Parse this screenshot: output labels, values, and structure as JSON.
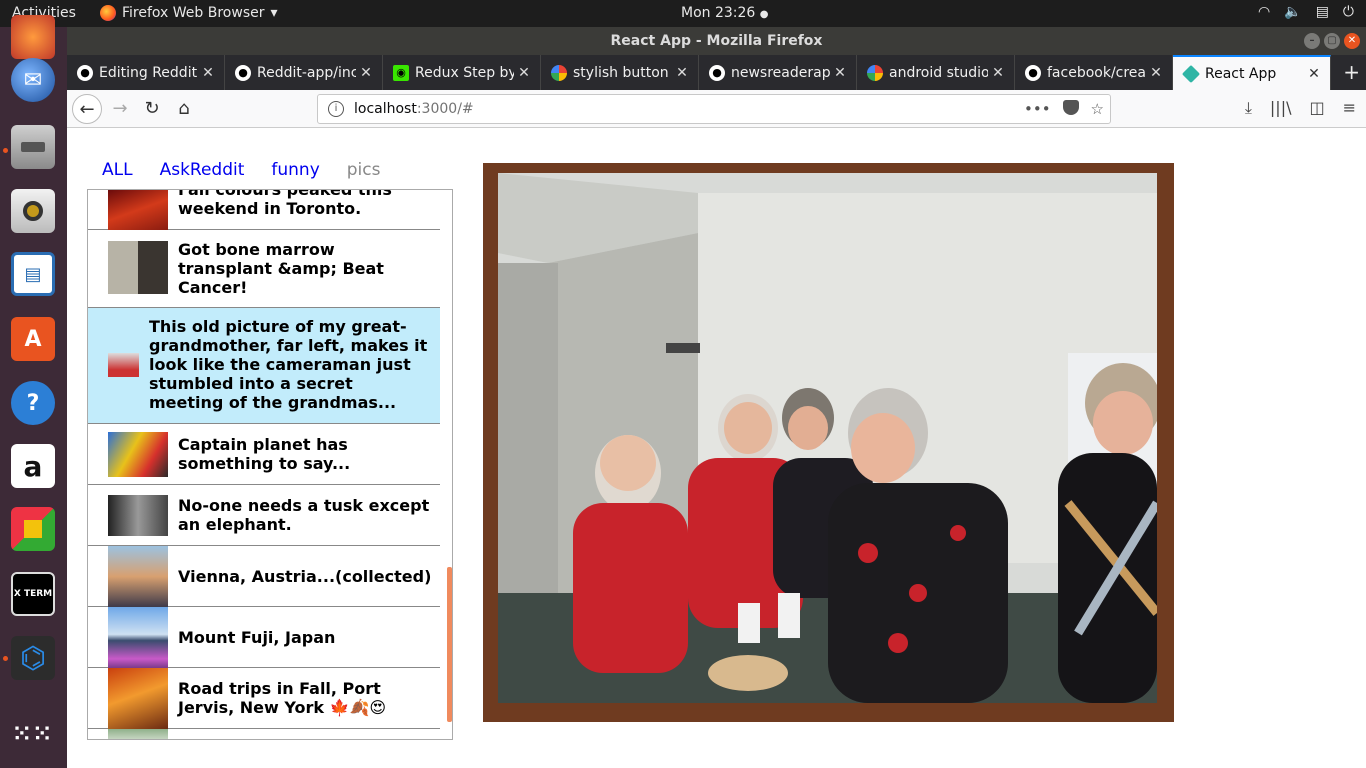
{
  "topbar": {
    "activities": "Activities",
    "app_name": "Firefox Web Browser",
    "app_menu_arrow": "▾",
    "clock": "Mon 23:26",
    "tray_icons": [
      "network-icon",
      "volume-icon",
      "clipboard-icon",
      "power-icon"
    ]
  },
  "launcher": {
    "items": [
      "firefox-icon",
      "thunderbird-icon",
      "files-icon",
      "rhythmbox-icon",
      "writer-icon",
      "software-center-icon",
      "help-icon",
      "amazon-icon",
      "office-icon",
      "xterm-icon",
      "vscode-icon",
      "app-grid-icon"
    ],
    "xterm_label": "X TERM",
    "help_glyph": "?",
    "amazon_glyph": "a",
    "store_glyph": "A"
  },
  "window": {
    "title": "React App - Mozilla Firefox",
    "controls": [
      "–",
      "▢",
      "✕"
    ]
  },
  "tabs": [
    {
      "label": "Editing Reddit",
      "icon": "github-icon",
      "active": false
    },
    {
      "label": "Reddit-app/inc",
      "icon": "github-icon",
      "active": false
    },
    {
      "label": "Redux Step by",
      "icon": "redux-icon",
      "active": false
    },
    {
      "label": "stylish button",
      "icon": "google-icon",
      "active": false
    },
    {
      "label": "newsreaderap",
      "icon": "github-icon",
      "active": false
    },
    {
      "label": "android studio",
      "icon": "google-icon",
      "active": false
    },
    {
      "label": "facebook/crea",
      "icon": "github-icon",
      "active": false
    },
    {
      "label": "React App",
      "icon": "react-cube-icon",
      "active": true
    }
  ],
  "tab_close_glyph": "✕",
  "new_tab_glyph": "+",
  "navbar": {
    "url_host": "localhost",
    "url_path": ":3000/#",
    "back_glyph": "←",
    "forward_glyph": "→",
    "reload_glyph": "↻",
    "home_glyph": "⌂",
    "page_actions_glyph": "•••",
    "bookmark_glyph": "☆",
    "info_glyph": "i",
    "download_glyph": "⤓",
    "library_glyph": "|||\\",
    "sidebar_glyph": "◫",
    "menu_glyph": "≡"
  },
  "subnav": {
    "links": [
      {
        "label": "ALL",
        "current": false
      },
      {
        "label": "AskReddit",
        "current": false
      },
      {
        "label": "funny",
        "current": false
      },
      {
        "label": "pics",
        "current": true
      }
    ]
  },
  "posts": [
    {
      "title": "Fall colours peaked this weekend in Toronto.",
      "thumb": "red-trees",
      "selected": false
    },
    {
      "title": "Got bone marrow transplant &amp; Beat Cancer!",
      "thumb": "two-people",
      "selected": false
    },
    {
      "title": "This old picture of my great-grandmother, far left, makes it look like the cameraman just stumbled into a secret meeting of the grandmas...",
      "thumb": "grandmas",
      "selected": true
    },
    {
      "title": "Captain planet has something to say...",
      "thumb": "painted-van",
      "selected": false
    },
    {
      "title": "No-one needs a tusk except an elephant.",
      "thumb": "elephant-bw",
      "selected": false
    },
    {
      "title": "Vienna, Austria...(collected)",
      "thumb": "vienna",
      "selected": false
    },
    {
      "title": "Mount Fuji, Japan",
      "thumb": "fuji",
      "selected": false
    },
    {
      "title": "Road trips in Fall, Port Jervis, New York 🍁🍂😍",
      "thumb": "fall-road",
      "selected": false
    }
  ],
  "colors": {
    "selected_row": "#c2ecfb",
    "scrollbar": "#f08a5d",
    "link": "#0000ee",
    "tab_accent": "#0a84ff"
  }
}
